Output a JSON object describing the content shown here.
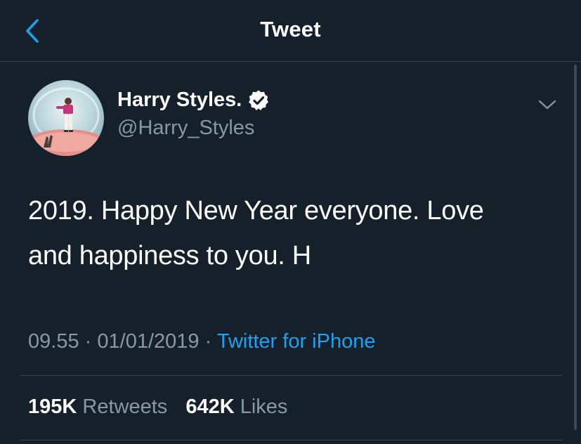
{
  "header": {
    "title": "Tweet",
    "back_icon": "chevron-left-icon"
  },
  "author": {
    "name": "Harry Styles.",
    "handle": "@Harry_Styles",
    "verified": true,
    "avatar_icon": "profile-photo"
  },
  "tweet": {
    "text_line_1": "2019. Happy New Year everyone. Love",
    "text_line_2": "and happiness to you. H",
    "time": "09.55",
    "separator": "·",
    "date": "01/01/2019",
    "source": "Twitter for iPhone"
  },
  "stats": {
    "retweets_count": "195K",
    "retweets_label": "Retweets",
    "likes_count": "642K",
    "likes_label": "Likes"
  },
  "colors": {
    "background": "#15202b",
    "accent": "#1da1f2",
    "muted_text": "#8899a6",
    "divider": "#38444d"
  }
}
